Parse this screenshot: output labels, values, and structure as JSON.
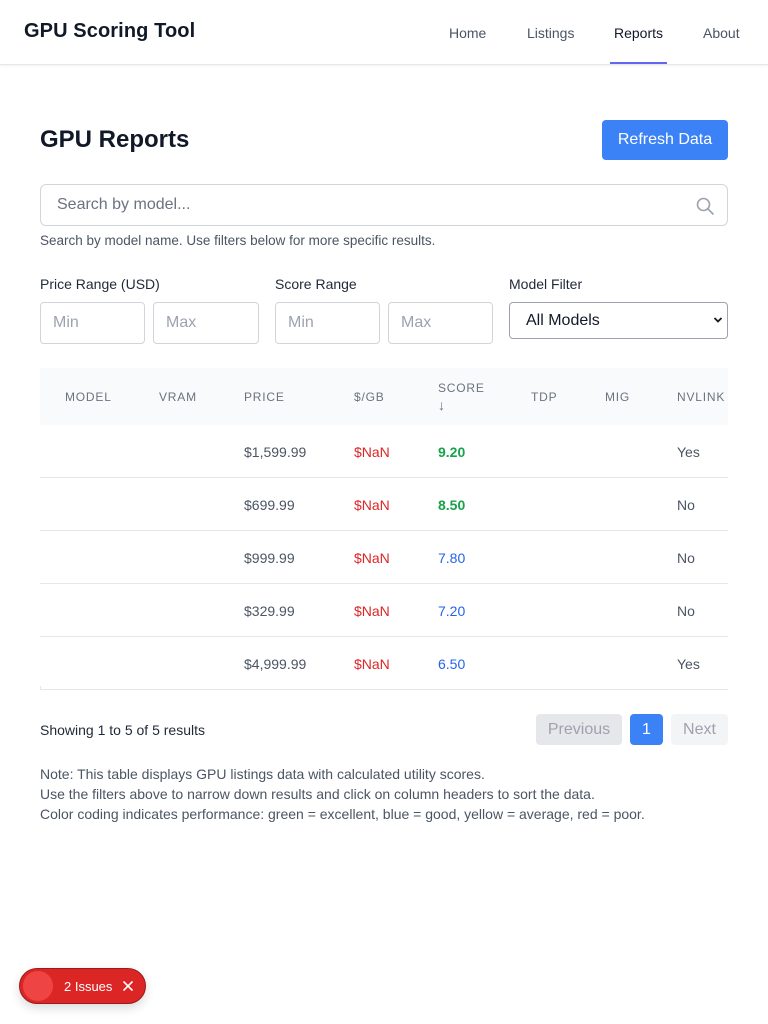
{
  "header": {
    "brand": "GPU Scoring Tool",
    "nav": [
      "Home",
      "Listings",
      "Reports",
      "About"
    ],
    "active_nav": "Reports"
  },
  "page": {
    "title": "GPU Reports",
    "refresh_label": "Refresh Data"
  },
  "search": {
    "placeholder": "Search by model...",
    "help": "Search by model name. Use filters below for more specific results."
  },
  "filters": {
    "price_label": "Price Range (USD)",
    "score_label": "Score Range",
    "model_label": "Model Filter",
    "min_placeholder": "Min",
    "max_placeholder": "Max",
    "model_selected": "All Models"
  },
  "table": {
    "columns": [
      "Model",
      "VRAM",
      "Price",
      "$/GB",
      "Score",
      "TDP",
      "MIG",
      "NVLink"
    ],
    "sort_indicator": "↓",
    "rows": [
      {
        "model": "",
        "vram": "",
        "price": "$1,599.99",
        "per_gb": "$NaN",
        "score": "9.20",
        "tdp": "",
        "mig": "",
        "nvlink": "Yes"
      },
      {
        "model": "",
        "vram": "",
        "price": "$699.99",
        "per_gb": "$NaN",
        "score": "8.50",
        "tdp": "",
        "mig": "",
        "nvlink": "No"
      },
      {
        "model": "",
        "vram": "",
        "price": "$999.99",
        "per_gb": "$NaN",
        "score": "7.80",
        "tdp": "",
        "mig": "",
        "nvlink": "No"
      },
      {
        "model": "",
        "vram": "",
        "price": "$329.99",
        "per_gb": "$NaN",
        "score": "7.20",
        "tdp": "",
        "mig": "",
        "nvlink": "No"
      },
      {
        "model": "",
        "vram": "",
        "price": "$4,999.99",
        "per_gb": "$NaN",
        "score": "6.50",
        "tdp": "",
        "mig": "",
        "nvlink": "Yes"
      }
    ]
  },
  "pagination": {
    "info": "Showing 1 to 5 of 5 results",
    "previous": "Previous",
    "current_page": "1",
    "next": "Next"
  },
  "notes": [
    "Note: This table displays GPU listings data with calculated utility scores.",
    "Use the filters above to narrow down results and click on column headers to sort the data.",
    "Color coding indicates performance: green = excellent, blue = good, yellow = average, red = poor."
  ],
  "issues_badge": {
    "label": "2 Issues"
  },
  "colors": {
    "accent": "#3b82f6",
    "nav_underline": "#6366f1",
    "score_excellent": "#16a34a",
    "score_good": "#2563eb",
    "negative": "#dc2626"
  }
}
